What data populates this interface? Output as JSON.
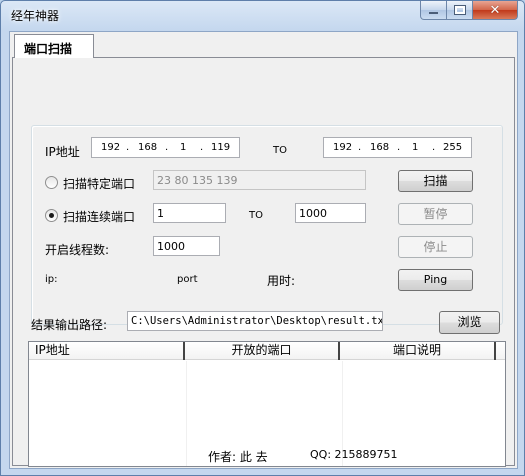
{
  "window": {
    "title": "经年神器",
    "controls": {
      "close_glyph": "✕"
    }
  },
  "tab": {
    "label": "端口扫描"
  },
  "scan": {
    "ip_label": "IP地址",
    "ip_start": [
      "192",
      "168",
      "1",
      "119"
    ],
    "to_label_ip": "TO",
    "ip_end": [
      "192",
      "168",
      "1",
      "255"
    ],
    "specific_ports_radio_label": "扫描特定端口",
    "specific_ports_value": "23 80 135 139",
    "specific_ports_checked": false,
    "continuous_ports_radio_label": "扫描连续端口",
    "continuous_ports_checked": true,
    "port_start": "1",
    "to_label_port": "TO",
    "port_end": "1000",
    "threads_label": "开启线程数:",
    "threads_value": "1000",
    "status_ip_label": "ip:",
    "status_port_label": "port",
    "status_time_label": "用时:"
  },
  "buttons": {
    "scan": "扫描",
    "pause": "暂停",
    "stop": "停止",
    "ping": "Ping",
    "browse": "浏览"
  },
  "output": {
    "path_label": "结果输出路径:",
    "path_value": "C:\\Users\\Administrator\\Desktop\\result.txt"
  },
  "results_table": {
    "columns": [
      "IP地址",
      "开放的端口",
      "端口说明"
    ],
    "rows": []
  },
  "footer": {
    "author_label": "作者: 此  去",
    "qq_label": "QQ: 215889751"
  },
  "colors": {
    "frame": "#c4d7ee",
    "panel": "#f0f0f0",
    "close_button": "#c0391b"
  }
}
